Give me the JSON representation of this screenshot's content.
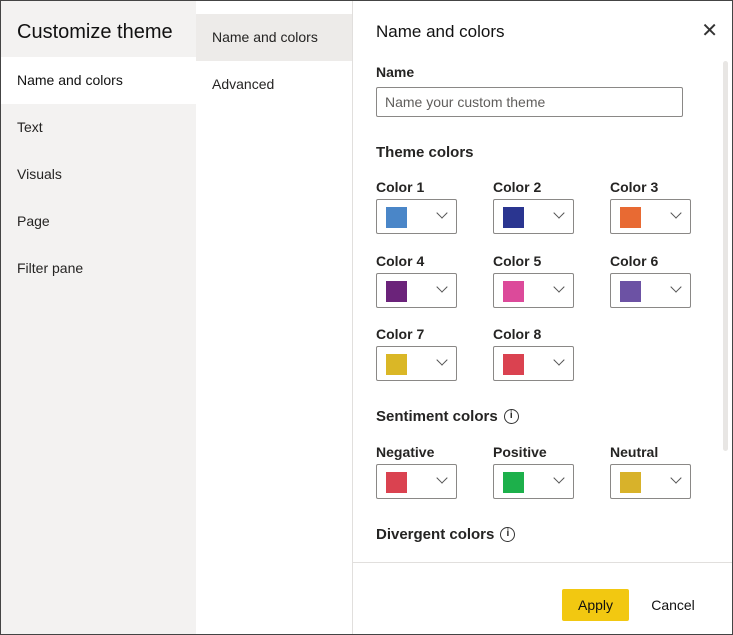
{
  "sidebar": {
    "title": "Customize theme",
    "items": [
      {
        "label": "Name and colors"
      },
      {
        "label": "Text"
      },
      {
        "label": "Visuals"
      },
      {
        "label": "Page"
      },
      {
        "label": "Filter pane"
      }
    ]
  },
  "subnav": {
    "items": [
      {
        "label": "Name and colors"
      },
      {
        "label": "Advanced"
      }
    ]
  },
  "panel": {
    "title": "Name and colors",
    "name_label": "Name",
    "name_placeholder": "Name your custom theme",
    "name_value": "",
    "theme_colors_heading": "Theme colors",
    "theme_colors": [
      {
        "label": "Color 1",
        "color": "#4a86c8"
      },
      {
        "label": "Color 2",
        "color": "#2a3590"
      },
      {
        "label": "Color 3",
        "color": "#e86a33"
      },
      {
        "label": "Color 4",
        "color": "#6b237a"
      },
      {
        "label": "Color 5",
        "color": "#dc4a9a"
      },
      {
        "label": "Color 6",
        "color": "#6c52a4"
      },
      {
        "label": "Color 7",
        "color": "#dab726"
      },
      {
        "label": "Color 8",
        "color": "#da4250"
      }
    ],
    "sentiment_heading": "Sentiment colors",
    "sentiment_colors": [
      {
        "label": "Negative",
        "color": "#da4250"
      },
      {
        "label": "Positive",
        "color": "#1db04b"
      },
      {
        "label": "Neutral",
        "color": "#d8b22a"
      }
    ],
    "divergent_heading": "Divergent colors"
  },
  "footer": {
    "apply": "Apply",
    "cancel": "Cancel"
  },
  "accent": "#f2c811"
}
